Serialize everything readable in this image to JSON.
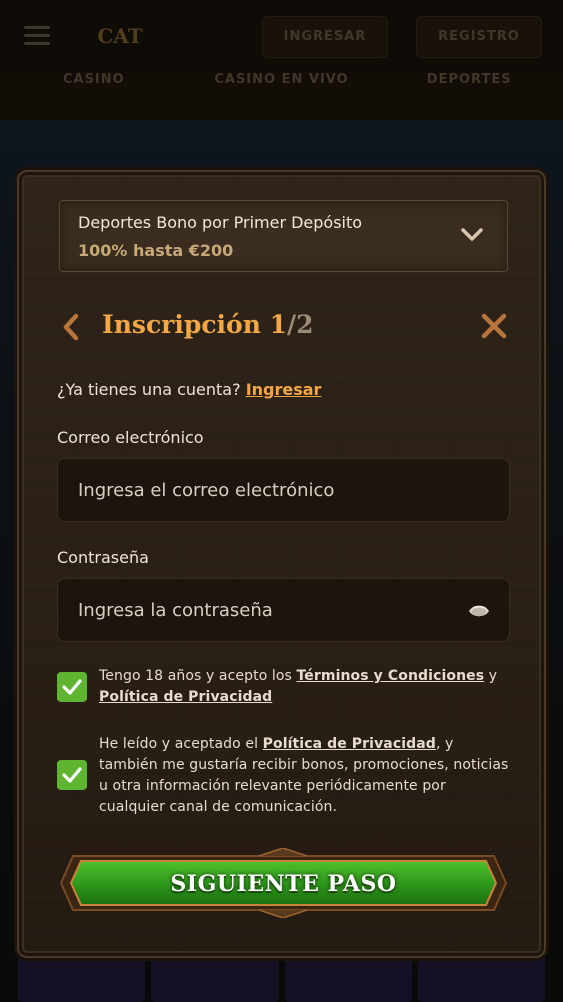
{
  "background": {
    "header": {
      "login_label": "INGRESAR",
      "register_label": "REGISTRO",
      "logo_text": "CAT"
    },
    "nav": [
      "CASINO",
      "CASINO EN VIVO",
      "DEPORTES"
    ]
  },
  "bonus": {
    "title": "Deportes Bono por Primer Depósito",
    "subtitle": "100% hasta €200",
    "icon": "chevron-down-icon"
  },
  "header": {
    "title": "Inscripción",
    "step_current": "1",
    "step_separator": "/",
    "step_total": "2"
  },
  "account_prompt": {
    "text": "¿Ya tienes una cuenta?",
    "link": "Ingresar"
  },
  "email": {
    "label": "Correo electrónico",
    "placeholder": "Ingresa el correo electrónico",
    "value": ""
  },
  "password": {
    "label": "Contraseña",
    "placeholder": "Ingresa la contraseña",
    "value": ""
  },
  "consent_terms": {
    "checked": true,
    "text_before": "Tengo 18 años y acepto los ",
    "link_terms": "Términos y Condiciones",
    "text_mid": " y ",
    "link_privacy": "Política de Privacidad"
  },
  "consent_marketing": {
    "checked": true,
    "text_before": "He leído y aceptado el ",
    "link_privacy": "Política de Privacidad",
    "text_after": ", y también me gustaría recibir bonos, promociones, noticias u otra información relevante periódicamente por cualquier canal de comunicación."
  },
  "cta": {
    "label": "SIGUIENTE PASO"
  },
  "colors": {
    "accent": "#f3a845",
    "checkbox": "#5fb430",
    "cta_green": "#2f9a1c",
    "panel": "#2a2016"
  }
}
